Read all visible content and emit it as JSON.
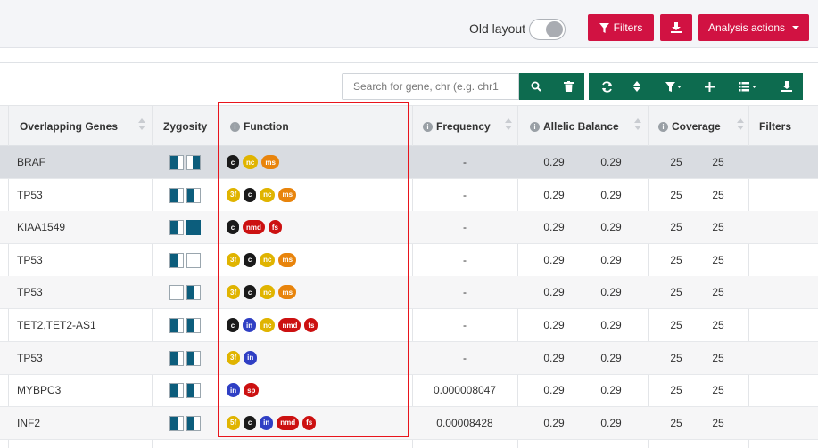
{
  "toolbar": {
    "old_layout_label": "Old layout",
    "filters_label": "Filters",
    "analysis_actions_label": "Analysis actions"
  },
  "search": {
    "placeholder": "Search for gene, chr (e.g. chr1"
  },
  "columns": {
    "overlapping_genes": "Overlapping Genes",
    "zygosity": "Zygosity",
    "function": "Function",
    "frequency": "Frequency",
    "allelic_balance": "Allelic Balance",
    "coverage": "Coverage",
    "filters": "Filters"
  },
  "rows": [
    {
      "gene": "BRAF",
      "freq": "-",
      "ab1": "0.29",
      "ab2": "0.29",
      "cov1": "25",
      "cov2": "25",
      "fn": [
        "c",
        "nc",
        "ms"
      ],
      "zyg": [
        "halfL",
        "half"
      ]
    },
    {
      "gene": "TP53",
      "freq": "-",
      "ab1": "0.29",
      "ab2": "0.29",
      "cov1": "25",
      "cov2": "25",
      "fn": [
        "3f",
        "c",
        "nc",
        "ms"
      ],
      "zyg": [
        "halfL",
        "halfL"
      ]
    },
    {
      "gene": "KIAA1549",
      "freq": "-",
      "ab1": "0.29",
      "ab2": "0.29",
      "cov1": "25",
      "cov2": "25",
      "fn": [
        "c",
        "nmd",
        "fs"
      ],
      "zyg": [
        "halfL",
        "full"
      ]
    },
    {
      "gene": "TP53",
      "freq": "-",
      "ab1": "0.29",
      "ab2": "0.29",
      "cov1": "25",
      "cov2": "25",
      "fn": [
        "3f",
        "c",
        "nc",
        "ms"
      ],
      "zyg": [
        "halfL",
        "empty"
      ]
    },
    {
      "gene": "TP53",
      "freq": "-",
      "ab1": "0.29",
      "ab2": "0.29",
      "cov1": "25",
      "cov2": "25",
      "fn": [
        "3f",
        "c",
        "nc",
        "ms"
      ],
      "zyg": [
        "empty",
        "halfL"
      ]
    },
    {
      "gene": "TET2,TET2-AS1",
      "freq": "-",
      "ab1": "0.29",
      "ab2": "0.29",
      "cov1": "25",
      "cov2": "25",
      "fn": [
        "c",
        "in",
        "nc",
        "nmd",
        "fs"
      ],
      "zyg": [
        "halfL",
        "halfL"
      ]
    },
    {
      "gene": "TP53",
      "freq": "-",
      "ab1": "0.29",
      "ab2": "0.29",
      "cov1": "25",
      "cov2": "25",
      "fn": [
        "3f",
        "in"
      ],
      "zyg": [
        "halfL",
        "halfL"
      ]
    },
    {
      "gene": "MYBPC3",
      "freq": "0.000008047",
      "ab1": "0.29",
      "ab2": "0.29",
      "cov1": "25",
      "cov2": "25",
      "fn": [
        "in",
        "sp"
      ],
      "zyg": [
        "halfL",
        "halfL"
      ]
    },
    {
      "gene": "INF2",
      "freq": "0.00008428",
      "ab1": "0.29",
      "ab2": "0.29",
      "cov1": "25",
      "cov2": "25",
      "fn": [
        "5f",
        "c",
        "in",
        "nmd",
        "fs"
      ],
      "zyg": [
        "halfL",
        "halfL"
      ]
    }
  ],
  "colors": {
    "brand_red": "#d11242",
    "toolbar_green": "#0d6b4f",
    "zygosity_blue": "#0c5d7c",
    "highlight_red": "#e8141c"
  }
}
